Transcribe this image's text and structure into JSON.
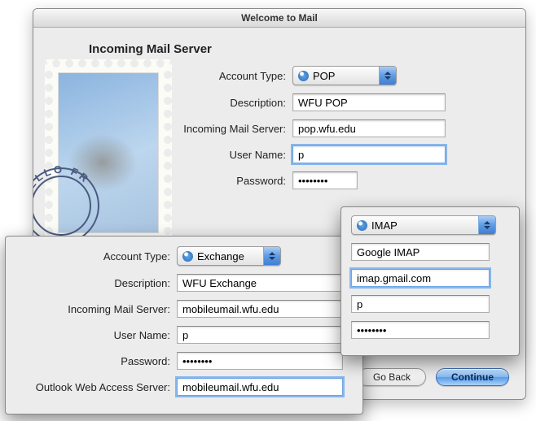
{
  "window": {
    "title": "Welcome to Mail",
    "section_title": "Incoming Mail Server"
  },
  "labels": {
    "account_type": "Account Type:",
    "description": "Description:",
    "incoming_server": "Incoming Mail Server:",
    "user_name": "User Name:",
    "password": "Password:",
    "owa_server": "Outlook Web Access Server:"
  },
  "pop": {
    "account_type": "POP",
    "description": "WFU POP",
    "server": "pop.wfu.edu",
    "user": "p",
    "password_mask": "••••••••"
  },
  "imap": {
    "account_type": "IMAP",
    "description": "Google IMAP",
    "server": "imap.gmail.com",
    "user": "p",
    "password_mask": "••••••••"
  },
  "exchange": {
    "account_type": "Exchange",
    "description": "WFU Exchange",
    "server": "mobileumail.wfu.edu",
    "user": "p",
    "password_mask": "••••••••",
    "owa": "mobileumail.wfu.edu"
  },
  "buttons": {
    "go_back": "Go Back",
    "continue": "Continue"
  },
  "postmark_text": "HELLO FR"
}
